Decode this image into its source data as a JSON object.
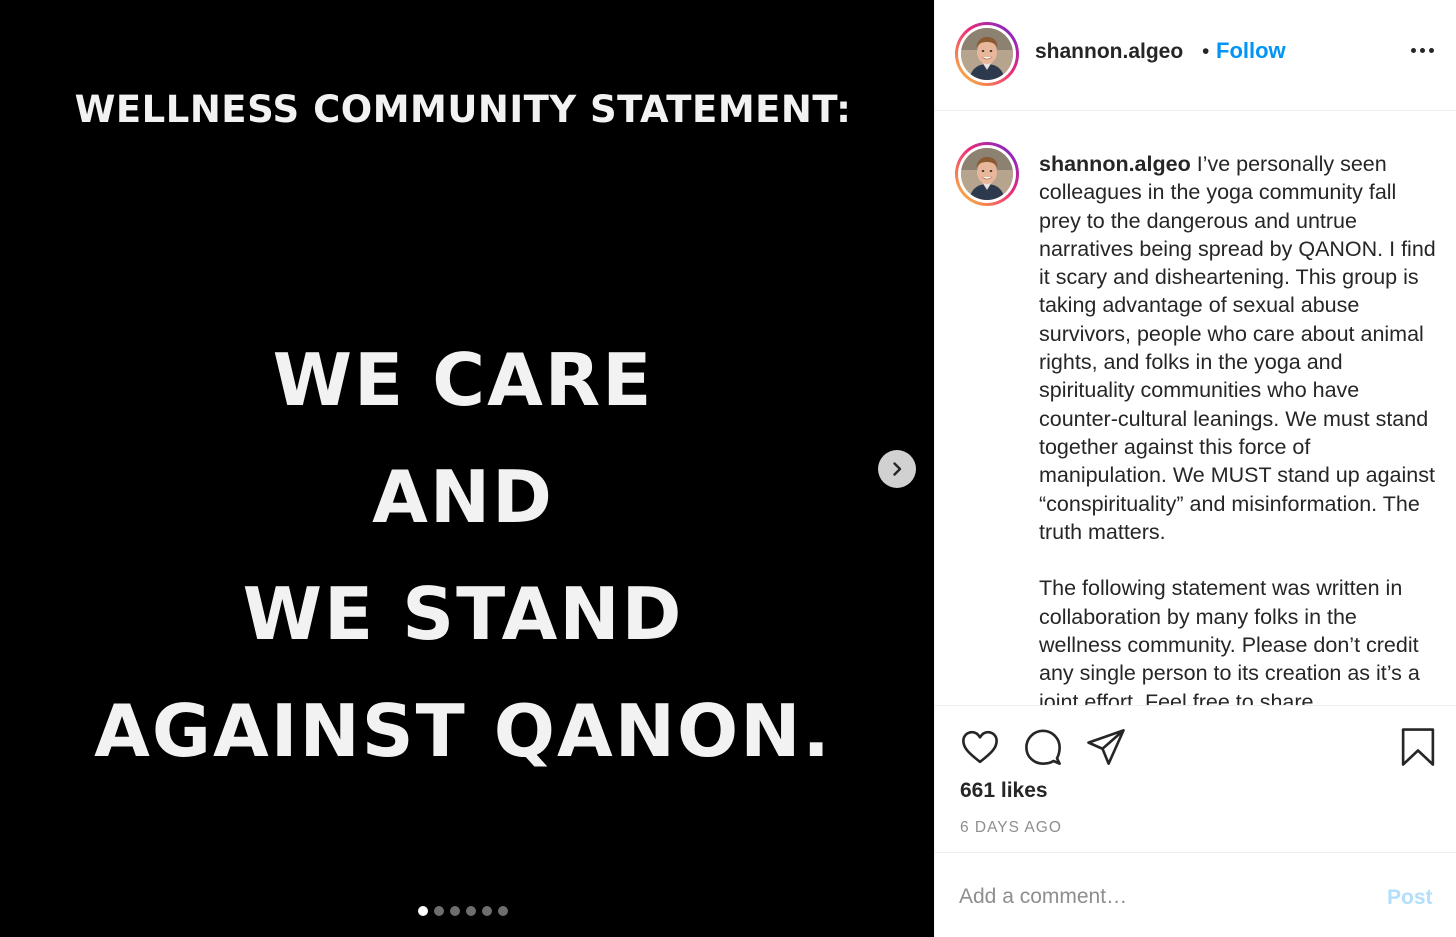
{
  "media": {
    "heading": "WELLNESS COMMUNITY STATEMENT:",
    "lines": [
      "WE CARE",
      "AND",
      "WE STAND",
      "AGAINST QANON."
    ],
    "carousel": {
      "total_slides": 6,
      "current_slide": 1
    },
    "next_icon": "chevron-right-icon"
  },
  "header": {
    "username": "shannon.algeo",
    "separator": "•",
    "follow_label": "Follow",
    "more_icon": "more-horizontal-icon"
  },
  "caption": {
    "username": "shannon.algeo",
    "text": " I’ve personally seen colleagues in the yoga community fall prey to the dangerous and untrue narratives being spread by QANON. I find it scary and disheartening. This group is taking advantage of sexual abuse survivors, people who care about animal rights, and folks in the yoga and spirituality communities who have counter-cultural leanings. We must stand together against this force of manipulation. We MUST stand up against “conspirituality” and misinformation. The truth matters.\n\nThe following statement was written in collaboration by many folks in the wellness community. Please don’t credit any single person to its creation as it’s a joint effort. Feel free to share."
  },
  "actions": {
    "icons": [
      "heart-icon",
      "comment-icon",
      "share-icon",
      "bookmark-icon"
    ],
    "likes": "661 likes",
    "timestamp": "6 DAYS AGO"
  },
  "comment": {
    "placeholder": "Add a comment…",
    "post_label": "Post"
  },
  "colors": {
    "link_blue": "#0095f6",
    "post_disabled": "#b2dffc",
    "muted_text": "#8e8e8e",
    "border": "#efefef"
  }
}
